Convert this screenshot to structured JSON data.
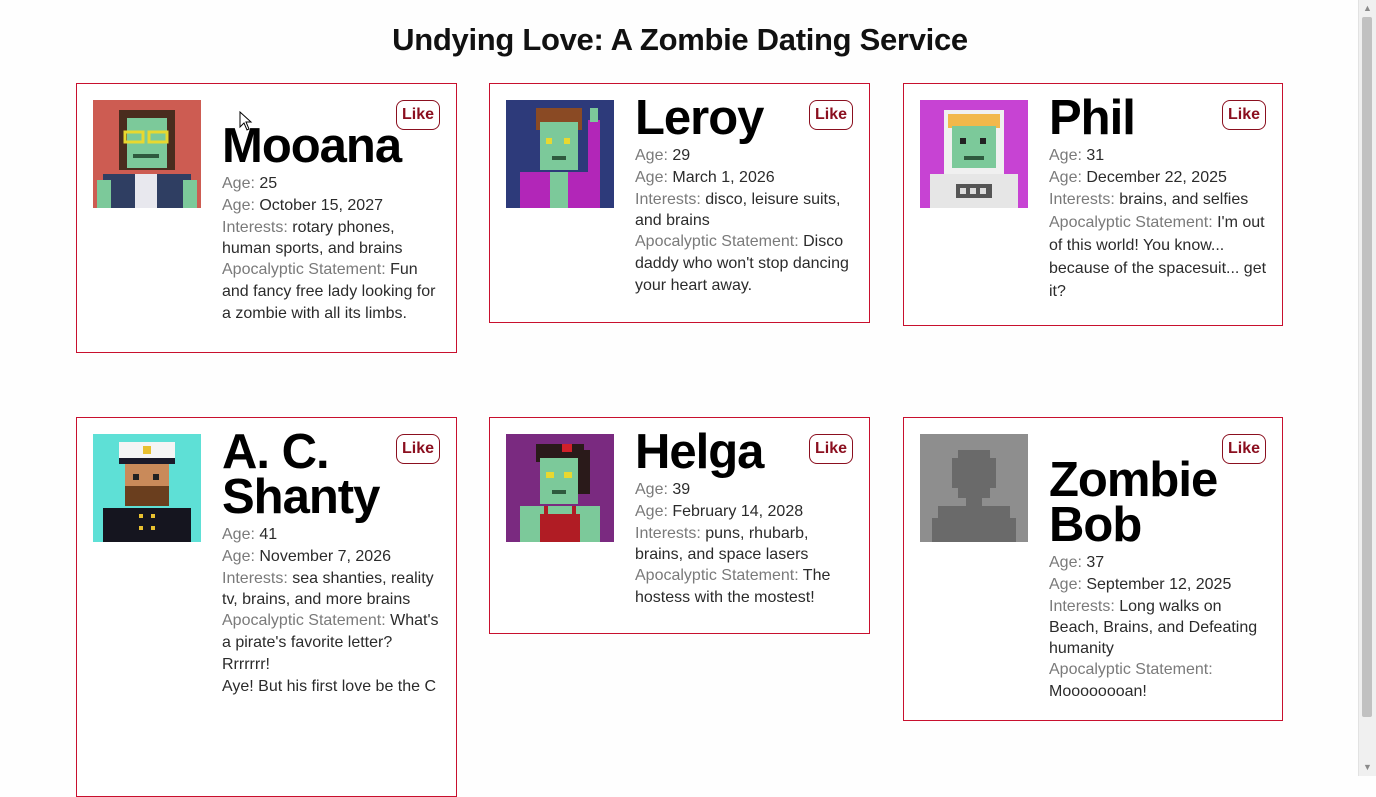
{
  "page": {
    "title": "Undying Love: A Zombie Dating Service",
    "accent_color": "#c8102e",
    "like_color": "#8b0f1f"
  },
  "labels": {
    "age": "Age: ",
    "interests": "Interests: ",
    "statement": "Apocalyptic Statement: "
  },
  "profiles": [
    {
      "name": "Mooana",
      "like_label": "Like",
      "age": "25",
      "date": "October 15, 2027",
      "interests": "rotary phones, human sports, and brains",
      "statement": "Fun and fancy free lady looking for a zombie with all its limbs.",
      "avatar_icon": "zombie-woman-glasses-avatar"
    },
    {
      "name": "Leroy",
      "like_label": "Like",
      "age": "29",
      "date": "March 1, 2026",
      "interests": "disco, leisure suits, and brains",
      "statement": "Disco daddy who won't stop dancing your heart away.",
      "avatar_icon": "zombie-disco-avatar"
    },
    {
      "name": "Phil",
      "like_label": "Like",
      "age": "31",
      "date": "December 22, 2025",
      "interests": "brains, and selfies",
      "statement": "I'm out of this world! You know... because of the spacesuit... get it?",
      "avatar_icon": "zombie-astronaut-avatar"
    },
    {
      "name": "A. C. Shanty",
      "like_label": "Like",
      "age": "41",
      "date": "November 7, 2026",
      "interests": "sea shanties, reality tv, brains, and more brains",
      "statement": "What's a pirate's favorite letter?",
      "statement_extra": [
        "Rrrrrrr!",
        "Aye! But his first love be the C"
      ],
      "avatar_icon": "zombie-sailor-avatar"
    },
    {
      "name": "Helga",
      "like_label": "Like",
      "age": "39",
      "date": "February 14, 2028",
      "interests": "puns, rhubarb, brains, and space lasers",
      "statement": "The hostess with the mostest!",
      "avatar_icon": "zombie-hostess-avatar"
    },
    {
      "name": "Zombie Bob",
      "like_label": "Like",
      "age": "37",
      "date": "September 12, 2025",
      "interests": "Long walks on Beach, Brains, and Defeating humanity",
      "statement": "Moooooooan!",
      "avatar_icon": "silhouette-placeholder-avatar"
    }
  ],
  "scrollbar": {
    "up_icon": "triangle-up-icon",
    "down_icon": "triangle-down-icon"
  }
}
